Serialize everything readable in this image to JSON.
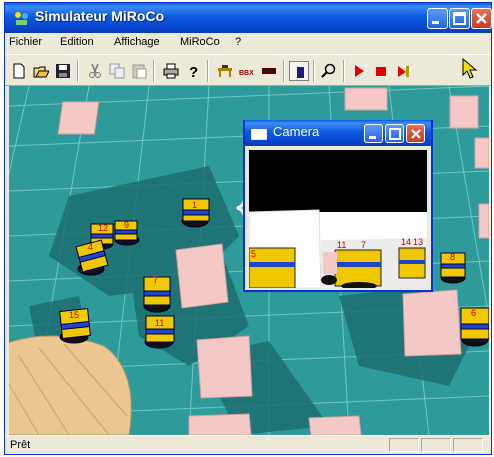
{
  "window": {
    "title": "Simulateur MiRoCo"
  },
  "menu": [
    "Fichier",
    "Edition",
    "Affichage",
    "MiRoCo",
    "?"
  ],
  "toolbar": {
    "buttons": [
      "new-icon",
      "open-icon",
      "save-icon",
      "cut-icon",
      "copy-icon",
      "paste-icon",
      "print-icon",
      "help-icon",
      "table-icon",
      "bbx-icon",
      "robot-icon",
      "select-icon",
      "zoom-icon",
      "play-icon",
      "stop-icon",
      "step-icon"
    ],
    "bbx_label": "BBX"
  },
  "camera": {
    "title": "Camera",
    "labels": [
      "5",
      "11",
      "7",
      "14",
      "13"
    ]
  },
  "robots": [
    "1",
    "12",
    "9",
    "4",
    "7",
    "15",
    "11",
    "8",
    "6"
  ],
  "status": {
    "text": "Prêt"
  },
  "colors": {
    "floor": "#2f9a9a",
    "robot": "#f0c800",
    "box": "#f5c8c8"
  }
}
